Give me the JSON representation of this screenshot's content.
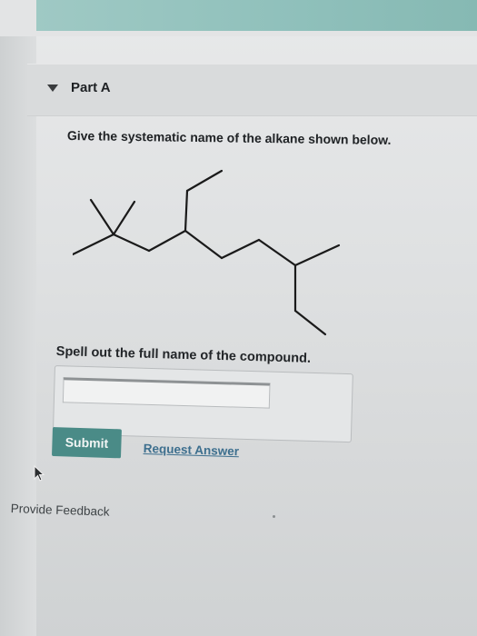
{
  "part": {
    "title": "Part A",
    "caret_icon": "caret-down-icon"
  },
  "question": {
    "prompt": "Give the systematic name of the alkane shown below.",
    "structure": "skeletal-formula-alkane"
  },
  "answer": {
    "instruction": "Spell out the full name of the compound.",
    "value": "",
    "placeholder": ""
  },
  "actions": {
    "submit_label": "Submit",
    "request_answer_label": "Request Answer"
  },
  "footer": {
    "feedback_label": "Provide Feedback"
  },
  "colors": {
    "accent_teal": "#8fc0bb",
    "submit_bg": "#4a8b87",
    "link": "#3d6f8e"
  }
}
